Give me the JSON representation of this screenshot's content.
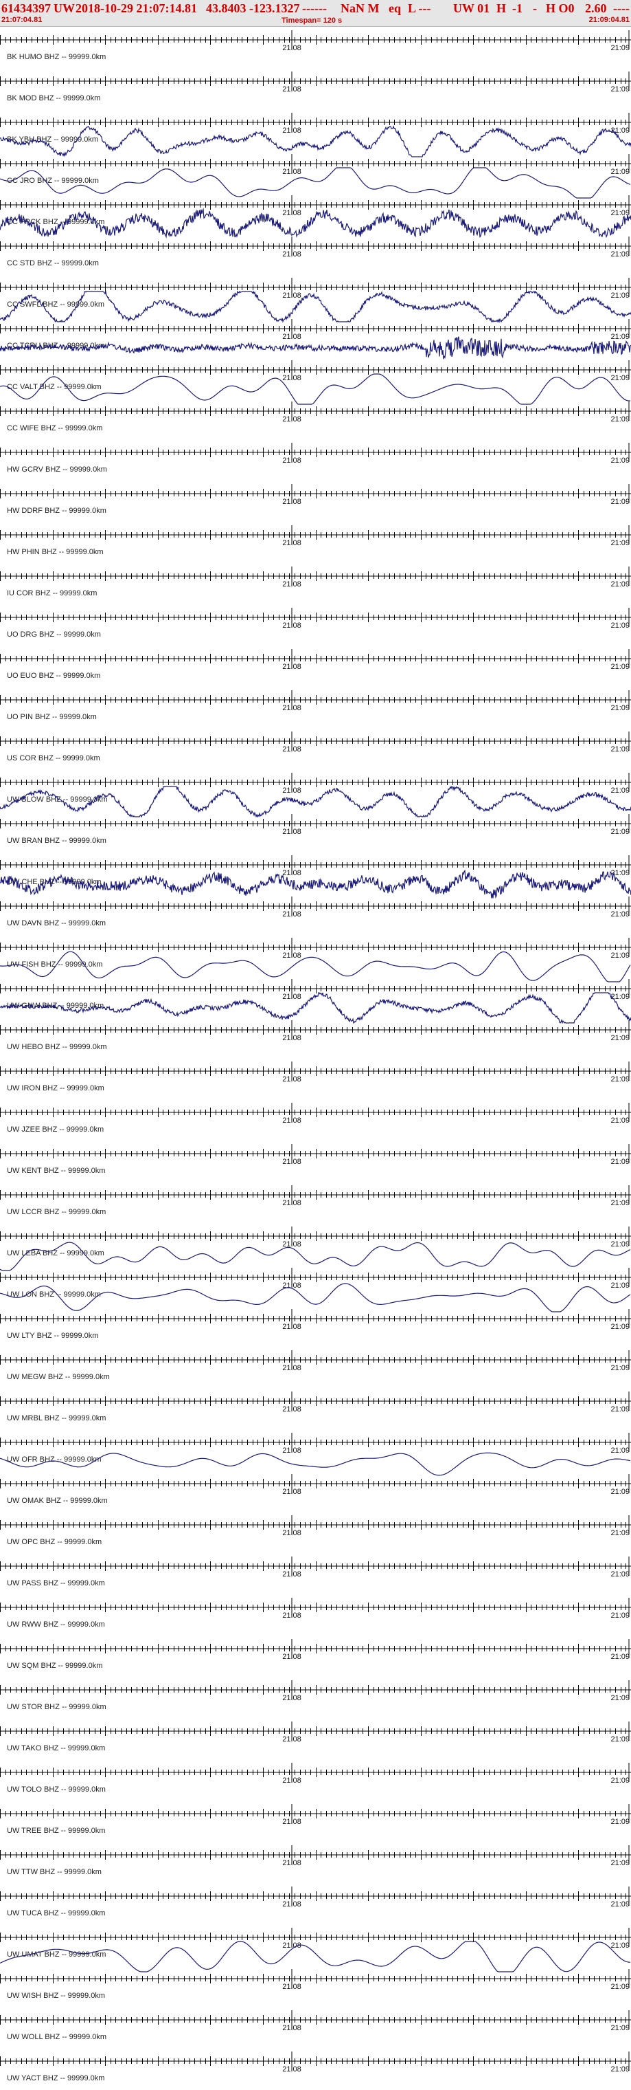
{
  "header": {
    "event_id": "61434397",
    "network": "UW",
    "origin_time": "2018-10-29 21:07:14.81",
    "location": "43.8403 -123.1327",
    "depth": "------",
    "magnitude": "NaN M",
    "event_type": "eq",
    "magnitude_type": "L ---",
    "version": "UW 01",
    "h_field": "H",
    "q_field": "-1",
    "quality": "-",
    "h0_field": "H O0",
    "rms": "2.60",
    "tail": "----",
    "start_time": "21:07:04.81",
    "end_time": "21:09:04.81",
    "timespan": "Timespan= 120 s"
  },
  "colors": {
    "header_text": "#d40000",
    "header_bg": "#e6e6e6",
    "trace": "#1a1a7a",
    "axis": "#000000",
    "label": "#222222"
  },
  "tick_labels": {
    "center": "21:08",
    "right": "21:09"
  },
  "channels": [
    {
      "label": "BK HUMO BHZ -- 99999.0km",
      "waveform": "none"
    },
    {
      "label": "BK MOD BHZ -- 99999.0km",
      "waveform": "none"
    },
    {
      "label": "BK YBH BHZ -- 99999.0km",
      "waveform": "mixed"
    },
    {
      "label": "CC JRO BHZ -- 99999.0km",
      "waveform": "smooth"
    },
    {
      "label": "CC PRCK BHZ -- 99999.0km",
      "waveform": "noisy"
    },
    {
      "label": "CC STD BHZ -- 99999.0km",
      "waveform": "none"
    },
    {
      "label": "CC SWFL BHZ -- 99999.0km",
      "waveform": "mixed"
    },
    {
      "label": "CC TCRU BHZ -- 99999.0km",
      "waveform": "burst"
    },
    {
      "label": "CC VALT BHZ -- 99999.0km",
      "waveform": "smooth"
    },
    {
      "label": "CC WIFE BHZ -- 99999.0km",
      "waveform": "none"
    },
    {
      "label": "HW GCRV BHZ -- 99999.0km",
      "waveform": "none"
    },
    {
      "label": "HW DDRF BHZ -- 99999.0km",
      "waveform": "none"
    },
    {
      "label": "HW PHIN BHZ -- 99999.0km",
      "waveform": "none"
    },
    {
      "label": "IU COR BHZ -- 99999.0km",
      "waveform": "none"
    },
    {
      "label": "UO DRG BHZ -- 99999.0km",
      "waveform": "none"
    },
    {
      "label": "UO EUO BHZ -- 99999.0km",
      "waveform": "none"
    },
    {
      "label": "UO PIN BHZ -- 99999.0km",
      "waveform": "none"
    },
    {
      "label": "US COR BHZ -- 99999.0km",
      "waveform": "none"
    },
    {
      "label": "UW BLOW BHZ -- 99999.0km",
      "waveform": "mixed"
    },
    {
      "label": "UW BRAN BHZ -- 99999.0km",
      "waveform": "none"
    },
    {
      "label": "UW CHE BHZ -- 99999.0km",
      "waveform": "noisy"
    },
    {
      "label": "UW DAVN BHZ -- 99999.0km",
      "waveform": "none"
    },
    {
      "label": "UW FISH BHZ -- 99999.0km",
      "waveform": "smooth"
    },
    {
      "label": "UW GNW BHZ -- 99999.0km",
      "waveform": "mixed"
    },
    {
      "label": "UW HEBO BHZ -- 99999.0km",
      "waveform": "none"
    },
    {
      "label": "UW IRON BHZ -- 99999.0km",
      "waveform": "none"
    },
    {
      "label": "UW JZEE BHZ -- 99999.0km",
      "waveform": "none"
    },
    {
      "label": "UW KENT BHZ -- 99999.0km",
      "waveform": "none"
    },
    {
      "label": "UW LCCR BHZ -- 99999.0km",
      "waveform": "none"
    },
    {
      "label": "UW LEBA BHZ -- 99999.0km",
      "waveform": "smooth"
    },
    {
      "label": "UW LON BHZ -- 99999.0km",
      "waveform": "smooth"
    },
    {
      "label": "UW LTY BHZ -- 99999.0km",
      "waveform": "none"
    },
    {
      "label": "UW MEGW BHZ -- 99999.0km",
      "waveform": "none"
    },
    {
      "label": "UW MRBL BHZ -- 99999.0km",
      "waveform": "none"
    },
    {
      "label": "UW OFR BHZ -- 99999.0km",
      "waveform": "smooth"
    },
    {
      "label": "UW OMAK BHZ -- 99999.0km",
      "waveform": "none"
    },
    {
      "label": "UW OPC BHZ -- 99999.0km",
      "waveform": "none"
    },
    {
      "label": "UW PASS BHZ -- 99999.0km",
      "waveform": "none"
    },
    {
      "label": "UW RWW BHZ -- 99999.0km",
      "waveform": "none"
    },
    {
      "label": "UW SQM BHZ -- 99999.0km",
      "waveform": "none"
    },
    {
      "label": "UW STOR BHZ -- 99999.0km",
      "waveform": "none"
    },
    {
      "label": "UW TAKO BHZ -- 99999.0km",
      "waveform": "none"
    },
    {
      "label": "UW TOLO BHZ -- 99999.0km",
      "waveform": "none"
    },
    {
      "label": "UW TREE BHZ -- 99999.0km",
      "waveform": "none"
    },
    {
      "label": "UW TTW BHZ -- 99999.0km",
      "waveform": "none"
    },
    {
      "label": "UW TUCA BHZ -- 99999.0km",
      "waveform": "none"
    },
    {
      "label": "UW UMAT BHZ -- 99999.0km",
      "waveform": "smooth"
    },
    {
      "label": "UW WISH BHZ -- 99999.0km",
      "waveform": "none"
    },
    {
      "label": "UW WOLL BHZ -- 99999.0km",
      "waveform": "none"
    },
    {
      "label": "UW YACT BHZ -- 99999.0km",
      "waveform": "none"
    }
  ]
}
